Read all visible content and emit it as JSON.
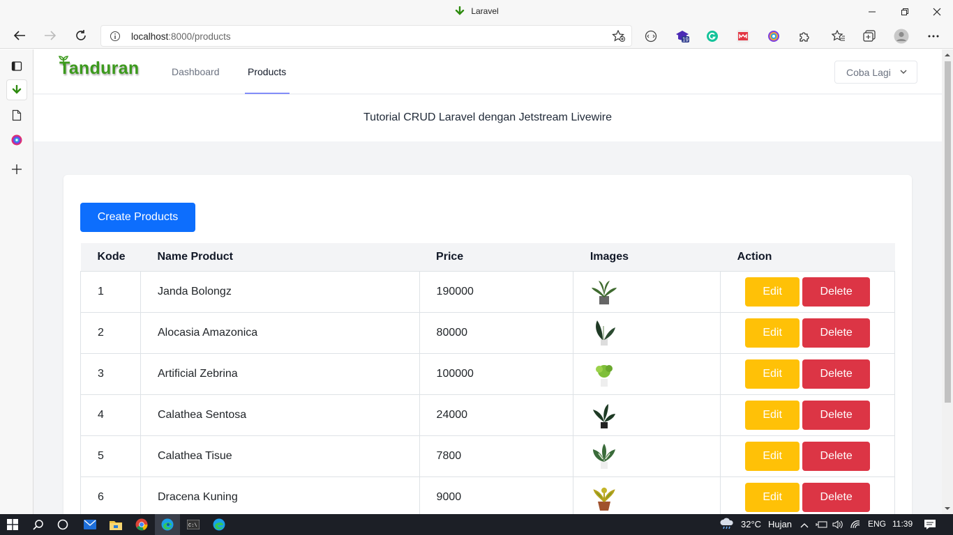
{
  "window": {
    "title": "Laravel"
  },
  "browser": {
    "url_host": "localhost",
    "url_rest": ":8000/products",
    "badge_count": "19"
  },
  "app": {
    "brand": "Tanduran",
    "nav": [
      {
        "label": "Dashboard"
      },
      {
        "label": "Products"
      }
    ],
    "user_menu": "Coba Lagi",
    "header": "Tutorial CRUD Laravel dengan Jetstream Livewire",
    "create_button": "Create Products",
    "table": {
      "columns": [
        "Kode",
        "Name Product",
        "Price",
        "Images",
        "Action"
      ],
      "rows": [
        {
          "kode": "1",
          "name": "Janda Bolongz",
          "price": "190000",
          "edit": "Edit",
          "delete": "Delete"
        },
        {
          "kode": "2",
          "name": "Alocasia Amazonica",
          "price": "80000",
          "edit": "Edit",
          "delete": "Delete"
        },
        {
          "kode": "3",
          "name": "Artificial Zebrina",
          "price": "100000",
          "edit": "Edit",
          "delete": "Delete"
        },
        {
          "kode": "4",
          "name": "Calathea Sentosa",
          "price": "24000",
          "edit": "Edit",
          "delete": "Delete"
        },
        {
          "kode": "5",
          "name": "Calathea Tisue",
          "price": "7800",
          "edit": "Edit",
          "delete": "Delete"
        },
        {
          "kode": "6",
          "name": "Dracena Kuning",
          "price": "9000",
          "edit": "Edit",
          "delete": "Delete"
        }
      ]
    }
  },
  "taskbar": {
    "weather": "32°C",
    "weather_text": "Hujan",
    "lang": "ENG",
    "time": "11:39"
  },
  "colors": {
    "primary": "#0d6efd",
    "warning": "#ffc107",
    "danger": "#dc3545",
    "brand": "#3c9a1d"
  }
}
